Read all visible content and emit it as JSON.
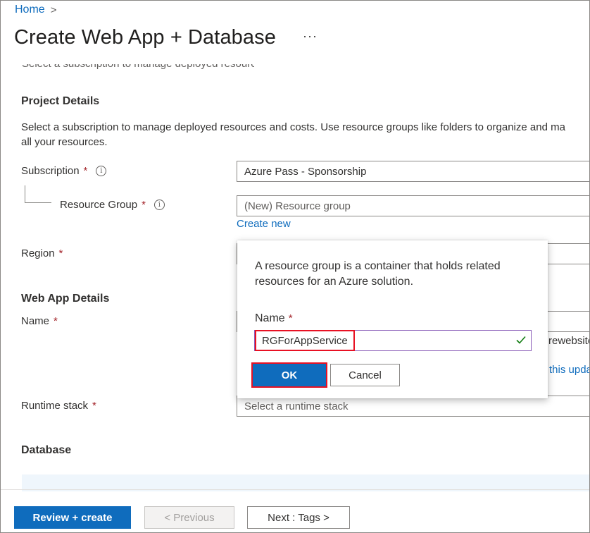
{
  "breadcrumb": {
    "home": "Home",
    "separator": ">"
  },
  "page_title": "Create Web App + Database",
  "more_label": "···",
  "cutoff_text": "Select a subscription to manage deployed resources and costs",
  "project_details": {
    "heading": "Project Details",
    "description_line1": "Select a subscription to manage deployed resources and costs. Use resource groups like folders to organize and ma",
    "description_line2": "all your resources."
  },
  "subscription": {
    "label": "Subscription",
    "required": "*",
    "value": "Azure Pass - Sponsorship"
  },
  "resource_group": {
    "label": "Resource Group",
    "required": "*",
    "placeholder": "(New) Resource group",
    "create_new": "Create new"
  },
  "region": {
    "label": "Region",
    "required": "*"
  },
  "web_app_details": {
    "heading": "Web App Details"
  },
  "name": {
    "label": "Name",
    "required": "*",
    "suffix_peek": "rewebsite",
    "link_peek": "this upda"
  },
  "runtime_stack": {
    "label": "Runtime stack",
    "required": "*",
    "placeholder": "Select a runtime stack"
  },
  "database": {
    "heading": "Database"
  },
  "callout": {
    "text": "A resource group is a container that holds related resources for an Azure solution.",
    "name_label": "Name",
    "required": "*",
    "name_value": "RGForAppService",
    "ok_label": "OK",
    "cancel_label": "Cancel"
  },
  "footer": {
    "review_create": "Review + create",
    "previous": "< Previous",
    "next": "Next : Tags >"
  },
  "colors": {
    "accent": "#0f6cbd",
    "required": "#a4262c",
    "highlight": "#e81123",
    "valid": "#107c10"
  },
  "icons": [
    "info-icon",
    "chevron-right-icon",
    "more-icon",
    "checkmark-icon"
  ]
}
